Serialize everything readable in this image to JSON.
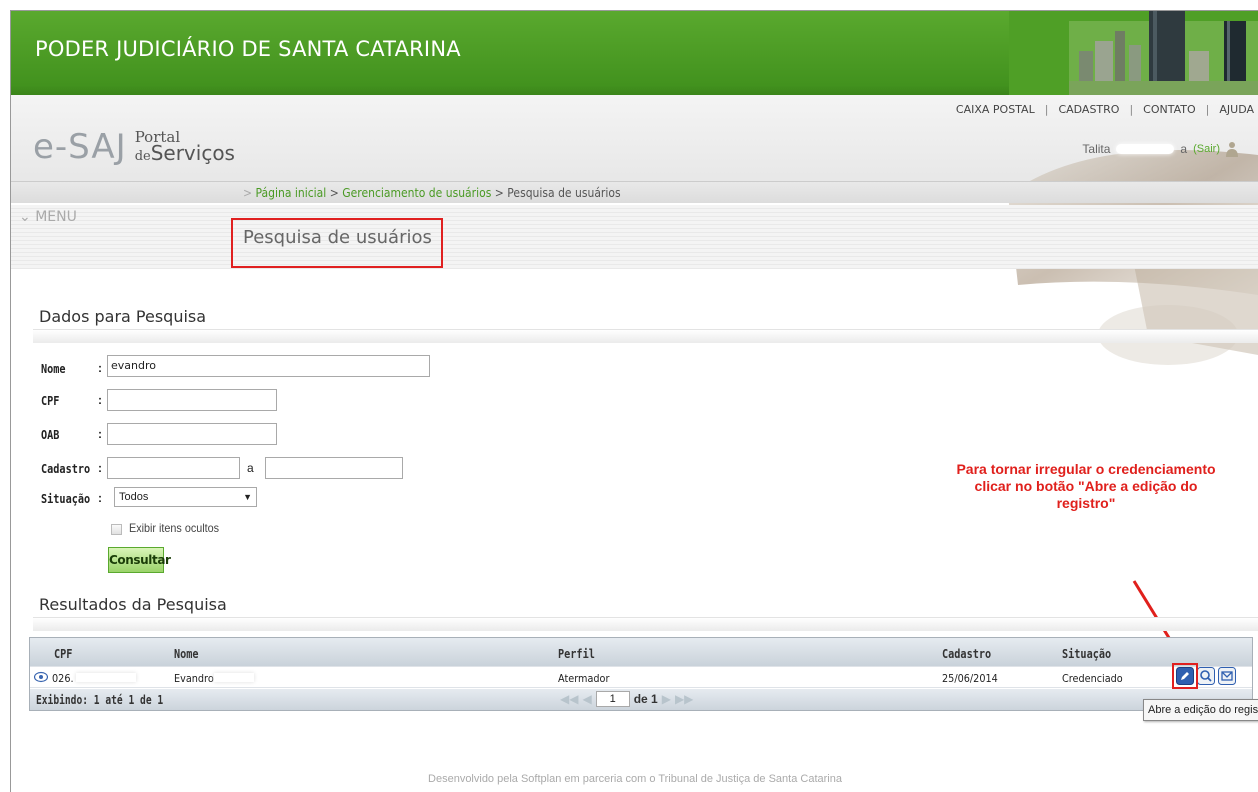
{
  "header": {
    "banner_title": "PODER JUDICIÁRIO DE SANTA CATARINA",
    "logo_main": "e-SAJ",
    "logo_portal": "Portal",
    "logo_de": "de",
    "logo_servicos": "Serviços",
    "links": [
      "CAIXA POSTAL",
      "CADASTRO",
      "CONTATO",
      "AJUDA"
    ],
    "user_name": "Talita",
    "user_suffix": "a",
    "sair_label": "(Sair)"
  },
  "breadcrumb": {
    "items": [
      "Página inicial",
      "Gerenciamento de usuários",
      "Pesquisa de usuários"
    ],
    "separator": ">"
  },
  "menu": {
    "label": "MENU"
  },
  "page": {
    "title": "Pesquisa de usuários"
  },
  "search": {
    "section_title": "Dados para Pesquisa",
    "labels": {
      "nome": "Nome",
      "cpf": "CPF",
      "oab": "OAB",
      "cadastro": "Cadastro",
      "situacao": "Situação",
      "cadastro_sep": "a"
    },
    "colon": ":",
    "values": {
      "nome": "evandro",
      "cpf": "",
      "oab": "",
      "cadastro_de": "",
      "cadastro_ate": ""
    },
    "situacao_selected": "Todos",
    "checkbox_label": "Exibir itens ocultos",
    "consultar_label": "Consultar"
  },
  "annotation": {
    "text": "Para tornar irregular o credenciamento clicar no botão \"Abre a edição do registro\"",
    "color": "#e0201c"
  },
  "results": {
    "section_title": "Resultados da Pesquisa",
    "columns": [
      "CPF",
      "Nome",
      "Perfil",
      "Cadastro",
      "Situação"
    ],
    "rows": [
      {
        "cpf": "026.",
        "nome": "Evandro",
        "perfil": "Atermador",
        "cadastro": "25/06/2014",
        "situacao": "Credenciado"
      }
    ],
    "exibindo": "Exibindo: 1 até 1 de 1",
    "page_current": "1",
    "page_of": "de 1"
  },
  "tooltip": {
    "text": "Abre a edição do registro"
  },
  "footer": {
    "text": "Desenvolvido pela Softplan em parceria com o Tribunal de Justiça de Santa Catarina"
  },
  "icons": {
    "view": "eye-icon",
    "edit": "pencil-icon",
    "details": "magnifier-icon",
    "message": "envelope-icon",
    "user": "user-icon"
  },
  "colors": {
    "header_green": "#4a9a24",
    "link_green": "#4a9a24",
    "highlight_red": "#e02020"
  }
}
